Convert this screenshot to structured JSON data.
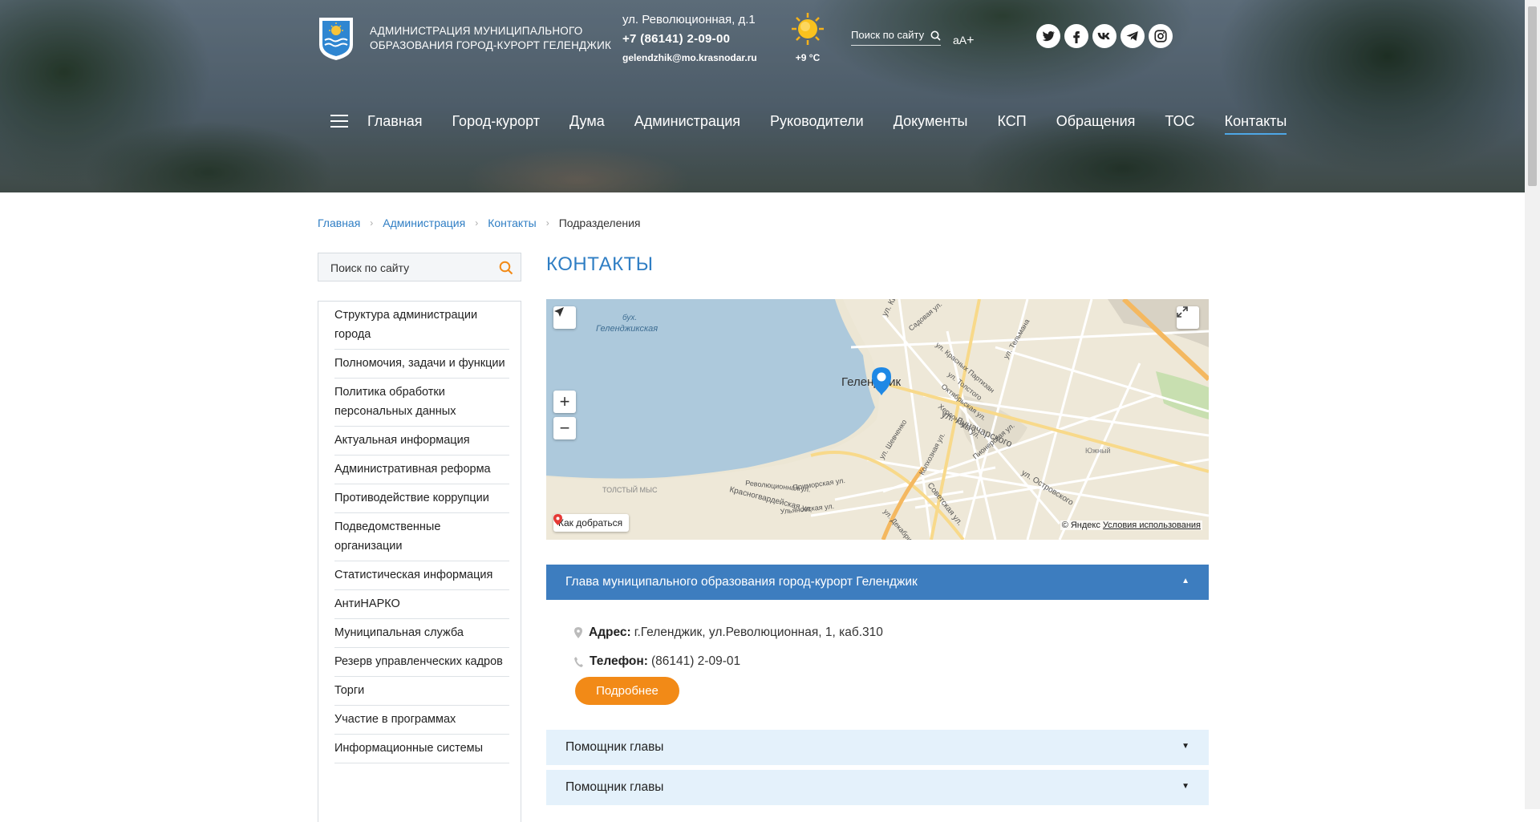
{
  "header": {
    "org_name_line1": "АДМИНИСТРАЦИЯ МУНИЦИПАЛЬНОГО",
    "org_name_line2": "ОБРАЗОВАНИЯ ГОРОД-КУРОРТ ГЕЛЕНДЖИК",
    "address": "ул. Революционная, д.1",
    "phone": "+7 (86141) 2-09-00",
    "email": "gelendzhik@mo.krasnodar.ru",
    "weather_temp": "+9 °C",
    "search_placeholder": "Поиск по сайту",
    "font_small": "аА",
    "font_plus": "+",
    "socials": [
      "twitter-icon",
      "facebook-icon",
      "vk-icon",
      "telegram-icon",
      "instagram-icon"
    ]
  },
  "nav": {
    "items": [
      "Главная",
      "Город-курорт",
      "Дума",
      "Администрация",
      "Руководители",
      "Документы",
      "КСП",
      "Обращения",
      "ТОС",
      "Контакты"
    ],
    "active": "Контакты"
  },
  "breadcrumb": {
    "items": [
      "Главная",
      "Администрация",
      "Контакты"
    ],
    "current": "Подразделения"
  },
  "sidebar": {
    "search_placeholder": "Поиск по сайту",
    "items": [
      "Структура администрации города",
      "Полномочия, задачи и функции",
      "Политика обработки персональных данных",
      "Актуальная информация",
      "Административная реформа",
      "Противодействие коррупции",
      "Подведомственные организации",
      "Статистическая информация",
      "АнтиНАРКО",
      "Муниципальная служба",
      "Резерв управленческих кадров",
      "Торги",
      "Участие в программах",
      "Информационные системы"
    ]
  },
  "main": {
    "title": "КОНТАКТЫ",
    "map": {
      "bay_label_1": "бух.",
      "bay_label_2": "Геленджикская",
      "city_label": "Геленджик",
      "streets": [
        "ул. Луначарского",
        "ул. Островского",
        "Советская ул.",
        "ул. Кирова",
        "Революционная ул.",
        "Приморская ул.",
        "Красногвардейская ул.",
        "Ульяновская ул.",
        "ул. Шевченко",
        "Колхозная ул.",
        "Херсонская ул.",
        "Октябрьская ул.",
        "ул. Толстого",
        "ул. Красных Партизан",
        "Садовая ул.",
        "ул. Тельмана",
        "Пионерская ул.",
        "ул. Декабристов",
        "Южный",
        "ТОЛСТЫЙ МЫС"
      ],
      "route_label": "Как добраться",
      "copyright": "© Яндекс",
      "terms": "Условия использования"
    },
    "accordion": [
      {
        "title": "Глава муниципального образования город-курорт Геленджик",
        "open": true
      },
      {
        "title": "Помощник главы",
        "open": false
      },
      {
        "title": "Помощник главы",
        "open": false
      }
    ],
    "details": {
      "address_label": "Адрес:",
      "address": "г.Геленджик, ул.Революционная, 1, каб.310",
      "phone_label": "Телефон:",
      "phone": "(86141) 2-09-01",
      "more_button": "Подробнее"
    }
  }
}
